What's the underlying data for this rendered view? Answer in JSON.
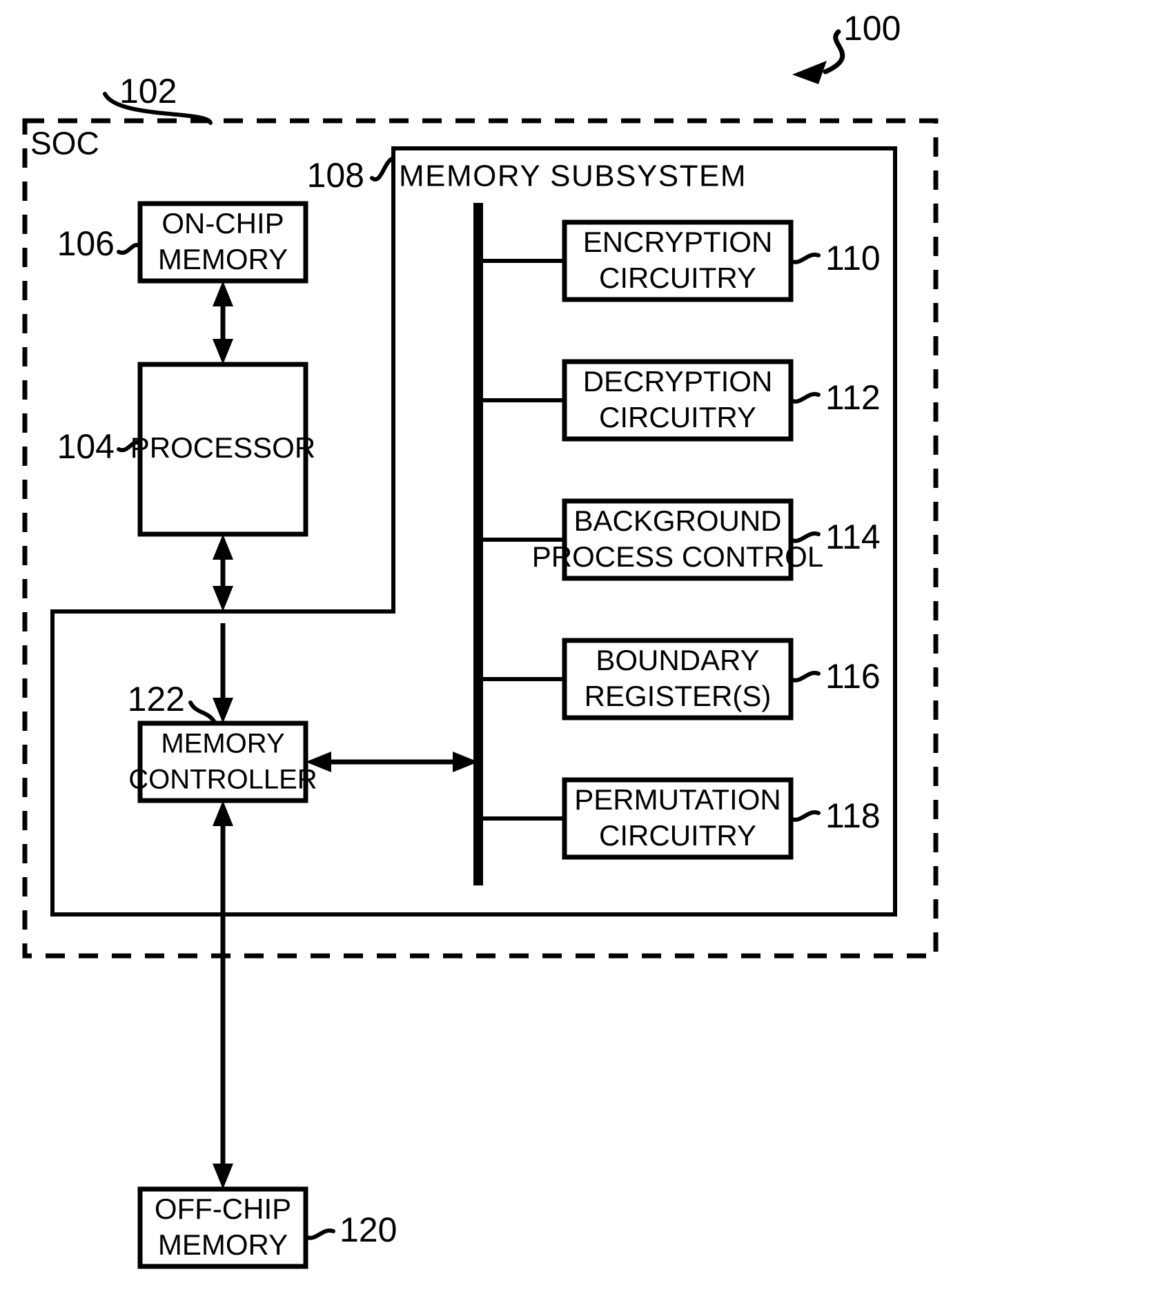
{
  "figure": {
    "figure_ref": "100",
    "soc": {
      "ref": "102",
      "label": "SOC"
    },
    "memory_subsystem": {
      "ref": "108",
      "label": "MEMORY SUBSYSTEM"
    },
    "blocks": [
      {
        "id": "on-chip-memory",
        "ref": "106",
        "line1": "ON-CHIP",
        "line2": "MEMORY"
      },
      {
        "id": "processor",
        "ref": "104",
        "line1": "PROCESSOR",
        "line2": ""
      },
      {
        "id": "memory-controller",
        "ref": "122",
        "line1": "MEMORY",
        "line2": "CONTROLLER"
      },
      {
        "id": "off-chip-memory",
        "ref": "120",
        "line1": "OFF-CHIP",
        "line2": "MEMORY"
      },
      {
        "id": "encryption-circuitry",
        "ref": "110",
        "line1": "ENCRYPTION",
        "line2": "CIRCUITRY"
      },
      {
        "id": "decryption-circuitry",
        "ref": "112",
        "line1": "DECRYPTION",
        "line2": "CIRCUITRY"
      },
      {
        "id": "background-process-control",
        "ref": "114",
        "line1": "BACKGROUND",
        "line2": "PROCESS CONTROL"
      },
      {
        "id": "boundary-registers",
        "ref": "116",
        "line1": "BOUNDARY",
        "line2": "REGISTER(S)"
      },
      {
        "id": "permutation-circuitry",
        "ref": "118",
        "line1": "PERMUTATION",
        "line2": "CIRCUITRY"
      }
    ],
    "colors": {
      "stroke": "#000000",
      "background": "#ffffff"
    }
  }
}
